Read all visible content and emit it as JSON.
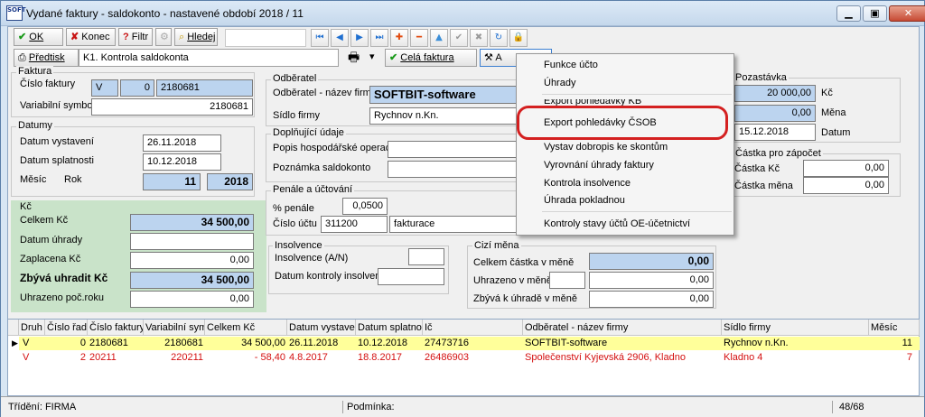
{
  "app": {
    "icon_text": "SOFT",
    "title": "Vydané faktury - saldokonto - nastavené období 2018 / 11"
  },
  "toolbar": {
    "ok": "OK",
    "konec": "Konec",
    "filtr": "Filtr",
    "hledej": "Hledej",
    "predtisk": "Předtisk",
    "report": "K1. Kontrola saldokonta",
    "cela_faktura": "Celá faktura",
    "extra_tail": "A"
  },
  "faktura": {
    "legend": "Faktura",
    "cislo_label": "Číslo faktury",
    "druh": "V",
    "rada": "0",
    "cislo": "2180681",
    "vs_label": "Variabilní symbol",
    "vs": "2180681"
  },
  "datumy": {
    "legend": "Datumy",
    "vystaveni_label": "Datum vystavení",
    "vystaveni": "26.11.2018",
    "splatnosti_label": "Datum splatnosti",
    "splatnosti": "10.12.2018",
    "mesic_label": "Měsíc",
    "rok_label": "Rok",
    "mesic": "11",
    "rok": "2018"
  },
  "kc": {
    "legend": "Kč",
    "celkem_label": "Celkem Kč",
    "celkem": "34 500,00",
    "uhrady_label": "Datum úhrady",
    "uhrady": "",
    "zaplacena_label": "Zaplacena Kč",
    "zaplacena": "0,00",
    "zbyva_label": "Zbývá uhradit Kč",
    "zbyva": "34 500,00",
    "uhrazeno_label": "Uhrazeno poč.roku",
    "uhrazeno": "0,00"
  },
  "odberatel": {
    "legend": "Odběratel",
    "nazev_label": "Odběratel - název firmy",
    "nazev": "SOFTBIT-software",
    "sidlo_label": "Sídlo firmy",
    "sidlo": "Rychnov n.Kn."
  },
  "doplnujici": {
    "legend": "Doplňující údaje",
    "popis_label": "Popis hospodářské operace",
    "popis": "",
    "poznamka_label": "Poznámka saldokonto",
    "poznamka": ""
  },
  "penale": {
    "legend": "Penále a účtování",
    "penale_label": "% penále",
    "penale": "0,0500",
    "ucet_label": "Číslo účtu",
    "ucet": "311200",
    "ucet_nazev": "fakturace"
  },
  "insolvence": {
    "legend": "Insolvence",
    "an_label": "Insolvence (A/N)",
    "an": "",
    "datum_label": "Datum kontroly insolvence",
    "datum": ""
  },
  "cizi": {
    "legend": "Cizí měna",
    "celkem_label": "Celkem částka v měně",
    "celkem": "0,00",
    "uhrazeno_label": "Uhrazeno v měně",
    "uhrazeno_mena": "",
    "uhrazeno": "0,00",
    "zbyva_label": "Zbývá k úhradě v měně",
    "zbyva": "0,00"
  },
  "pozastavka": {
    "legend": "Pozastávka",
    "castka": "20 000,00",
    "kc_label": "Kč",
    "mena_value": "0,00",
    "mena_label": "Měna",
    "datum": "15.12.2018",
    "datum_label": "Datum"
  },
  "zapocet": {
    "legend": "Částka pro zápočet",
    "kc_label": "Částka Kč",
    "kc": "0,00",
    "mena_label": "Částka měna",
    "mena": "0,00"
  },
  "menu": {
    "items": [
      "Funkce účto",
      "Úhrady",
      "Export pohledávky KB",
      "Export pohledávky ČSOB",
      "Vystav dobropis ke skontům",
      "Vyrovnání úhrady faktury",
      "Kontrola insolvence",
      "Úhrada pokladnou",
      "Kontroly stavy účtů OE-účetnictví"
    ]
  },
  "grid": {
    "headers": [
      "Druh",
      "Číslo řady",
      "Číslo faktury",
      "Variabilní symbol",
      "Celkem Kč",
      "Datum vystavení",
      "Datum splatnosti",
      "Ič",
      "Odběratel - název firmy",
      "Sídlo firmy",
      "Měsíc"
    ],
    "rows": [
      {
        "marker": "▶",
        "druh": "V",
        "rada": "0",
        "cislo": "2180681",
        "vs": "2180681",
        "celkem": "34 500,00",
        "vystaveni": "26.11.2018",
        "splatnosti": "10.12.2018",
        "ic": "27473716",
        "firma": "SOFTBIT-software",
        "sidlo": "Rychnov n.Kn.",
        "mesic": "11"
      },
      {
        "marker": "",
        "druh": "V",
        "rada": "2",
        "cislo": "20211",
        "vs": "220211",
        "celkem": "- 58,40",
        "vystaveni": "4.8.2017",
        "splatnosti": "18.8.2017",
        "ic": "26486903",
        "firma": "Společenství Kyjevská 2906, Kladno",
        "sidlo": "Kladno 4",
        "mesic": "7"
      }
    ]
  },
  "status": {
    "trideni": "Třídění: FIRMA",
    "podminka": "Podmínka:",
    "count": "48/68"
  },
  "colors": {
    "highlight_row": "#ffff9a",
    "red_text": "#d41010",
    "blue_field": "#bcd4ef",
    "green_panel": "#c9e3c9",
    "annotation_red": "#d42020"
  }
}
